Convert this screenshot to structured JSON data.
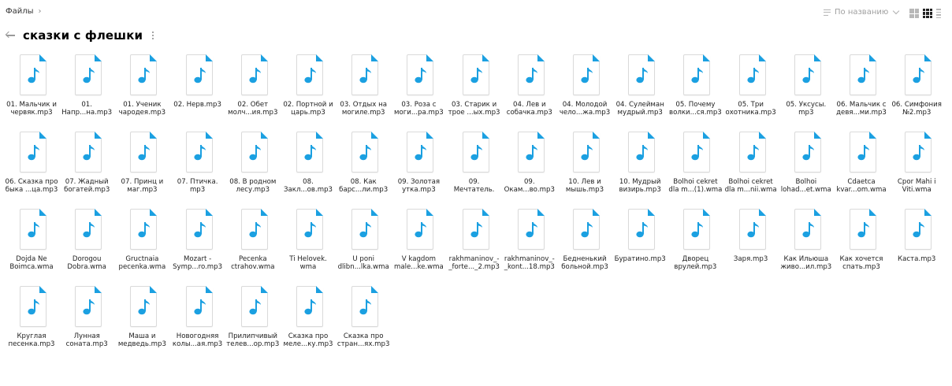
{
  "breadcrumb": {
    "root": "Файлы",
    "separator": "›"
  },
  "toolbar": {
    "sort_label": "По названию"
  },
  "folder": {
    "title": "сказки с флешки"
  },
  "accent": "#1ba0e1",
  "file_icon": "music-file-icon",
  "files": [
    "01. Мальчик и червяк.mp3",
    "01. Напр...на.mp3",
    "01. Ученик чародея.mp3",
    "02. Нерв.mp3",
    "02. Обет молч...ия.mp3",
    "02. Портной и царь.mp3",
    "03. Отдых на могиле.mp3",
    "03. Роза с моги...ра.mp3",
    "03. Старик и трое ...ых.mp3",
    "04. Лев и собачка.mp3",
    "04. Молодой чело...жа.mp3",
    "04. Сулейман мудрый.mp3",
    "05. Почему волки...ся.mp3",
    "05. Три охотника.mp3",
    "05. Уксусы. mp3",
    "06. Мальчик с девя...ми.mp3",
    "06. Симфония №2.mp3",
    "06. Сказка про быка ...ца.mp3",
    "07. Жадный богатей.mp3",
    "07. Принц и маг.mp3",
    "07. Птичка. mp3",
    "08. В родном лесу.mp3",
    "08. Закл...ов.mp3",
    "08. Как барс...ли.mp3",
    "09. Золотая утка.mp3",
    "09. Мечтатель. mp3",
    "09. Окам...во.mp3",
    "10. Лев и мышь.mp3",
    "10. Мудрый визирь.mp3",
    "Bolhoi cekret dla m...(1).wma",
    "Bolhoi cekret dla m...nii.wma",
    "Bolhoi lohad...et.wma",
    "Cdaetca kvar...om.wma",
    "Cpor Mahi i Viti.wma",
    "Dojda Ne Boimca.wma",
    "Dorogou Dobra.wma",
    "Gructnaia pecenka.wma",
    "Mozart - Symp...ro.mp3",
    "Pecenka ctrahov.wma",
    "Ti Helovek. wma",
    "U poni dlibn...lka.wma",
    "V kagdom male...ke.wma",
    "rakhmaninov_-_forte..._2.mp3",
    "rakhmaninov_-_kont...18.mp3",
    "Бедненький больной.mp3",
    "Буратино.mp3",
    "Дворец врулей.mp3",
    "Заря.mp3",
    "Как Ильюша живо...ил.mp3",
    "Как хочется спать.mp3",
    "Каста.mp3",
    "Круглая песенка.mp3",
    "Лунная соната.mp3",
    "Маша и медведь.mp3",
    "Новогодняя колы...ая.mp3",
    "Прилипчивый телев...ор.mp3",
    "Сказка про меле...ку.mp3",
    "Сказка про стран...ях.mp3"
  ]
}
